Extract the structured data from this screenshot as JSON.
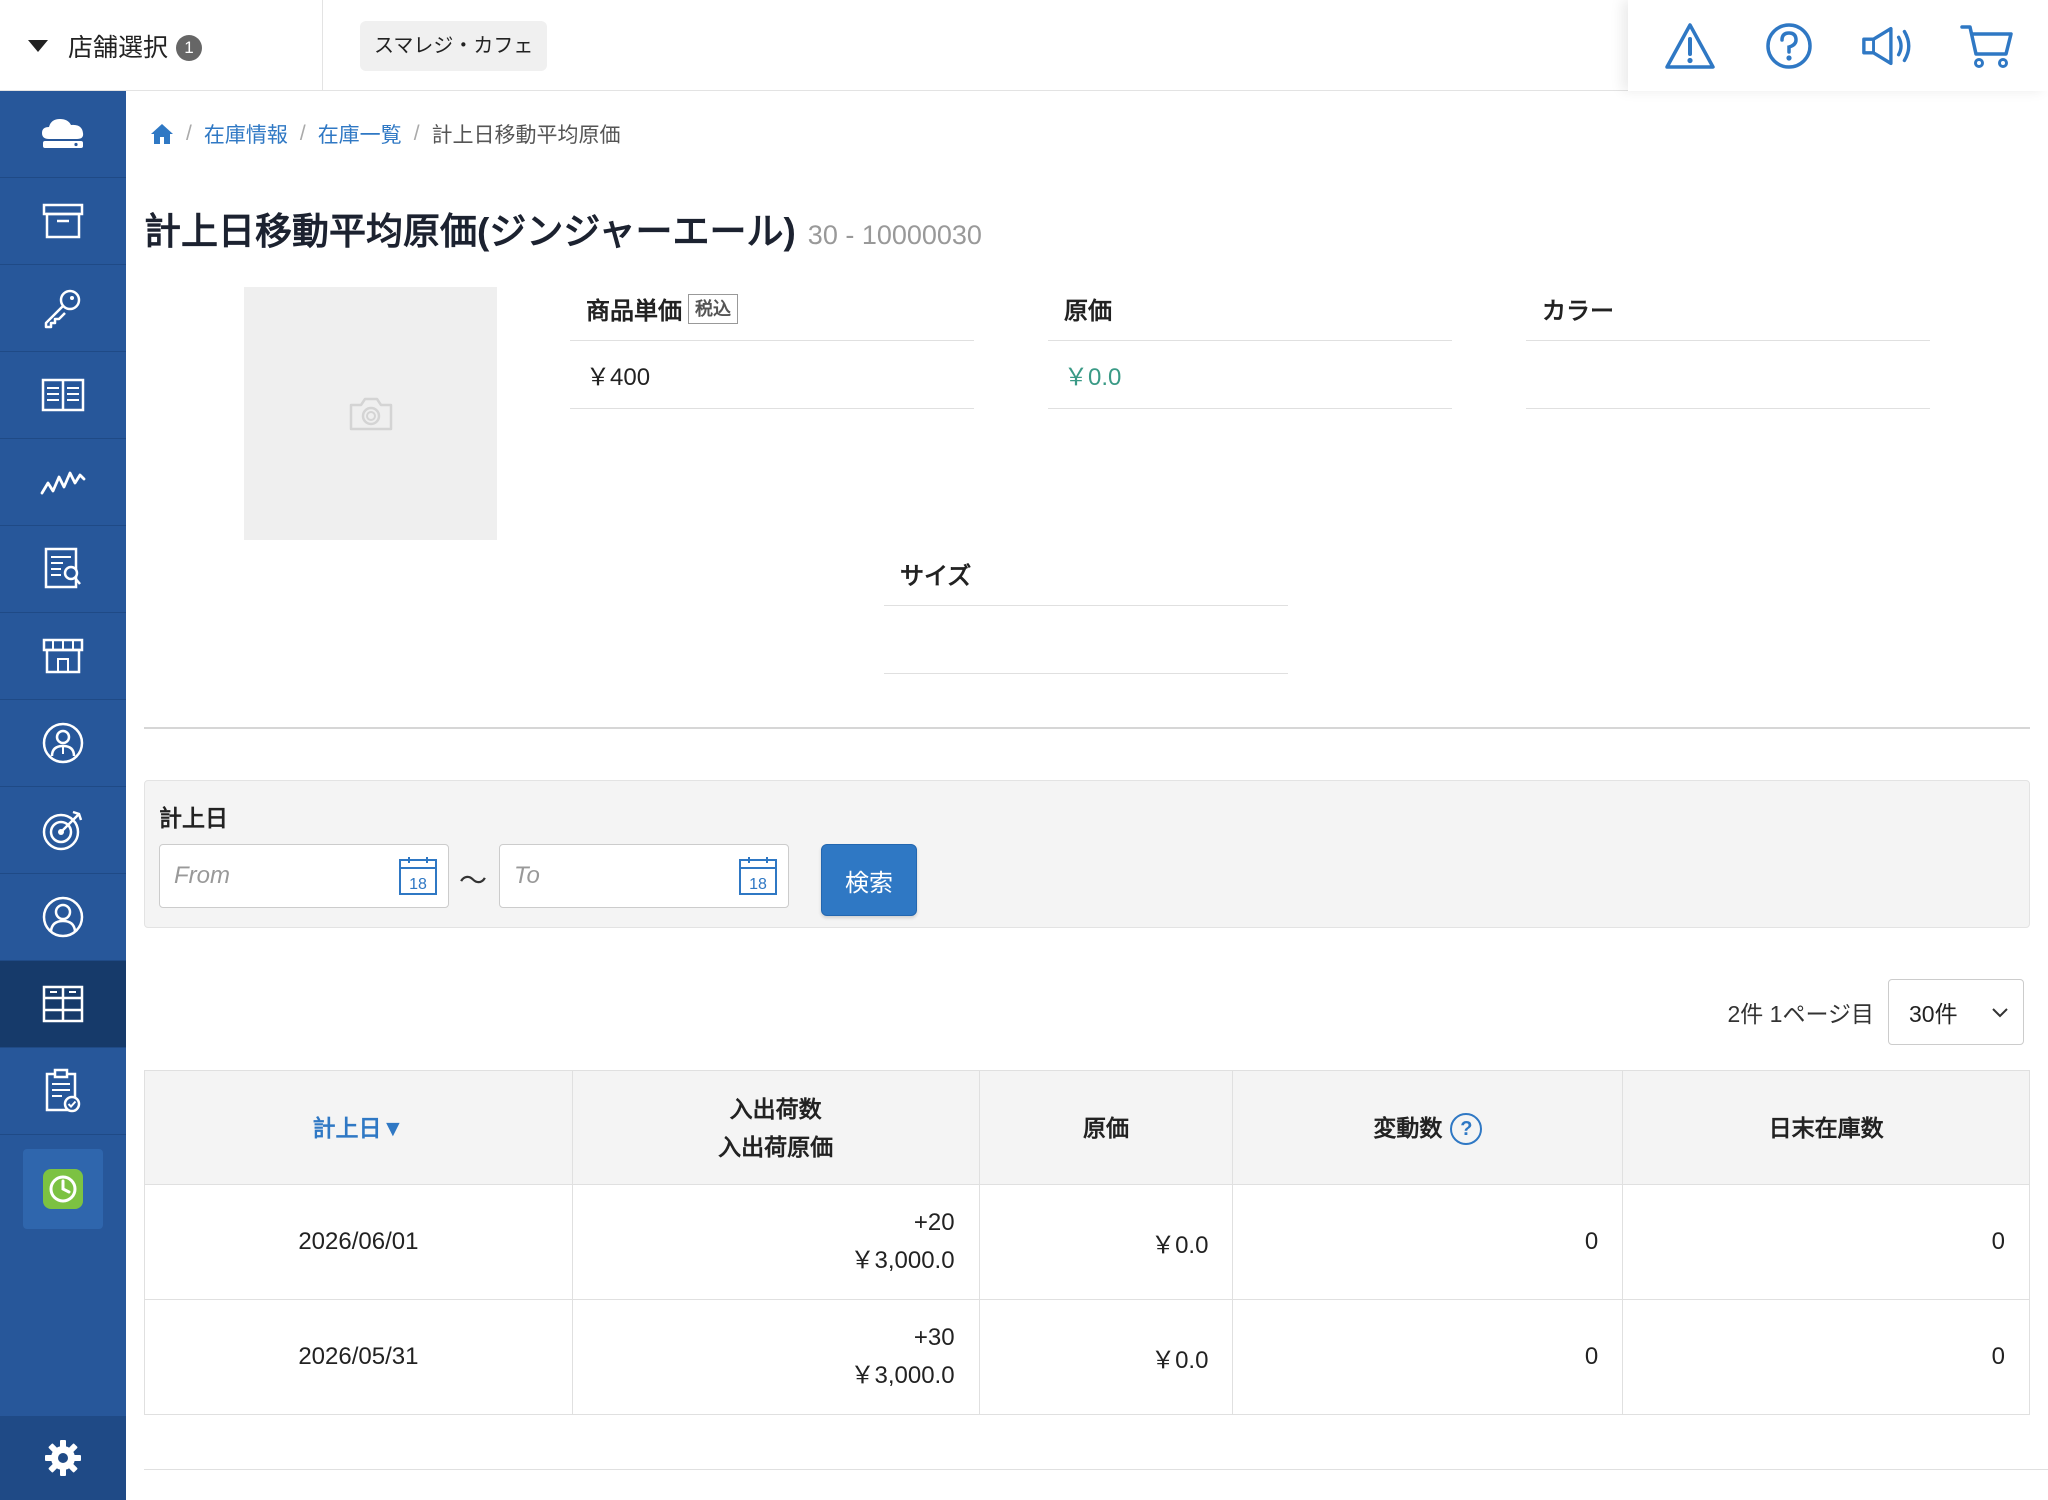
{
  "header": {
    "store_select_label": "店舗選択",
    "store_select_badge": "1",
    "current_store": "スマレジ・カフェ"
  },
  "icons": {
    "top": [
      "warning-icon",
      "help-icon",
      "announcement-icon",
      "cart-icon"
    ],
    "sidebar": [
      "cloud-icon",
      "archive-icon",
      "key-icon",
      "book-icon",
      "chart-icon",
      "report-icon",
      "store-icon",
      "staff-icon",
      "target-icon",
      "customer-icon",
      "inventory-icon",
      "clipboard-icon",
      "clock-icon",
      "gear-icon"
    ]
  },
  "breadcrumb": {
    "items": [
      "在庫情報",
      "在庫一覧"
    ],
    "current": "計上日移動平均原価"
  },
  "page": {
    "title": "計上日移動平均原価(ジンジャーエール)",
    "code": "30 - 10000030"
  },
  "attributes": {
    "price_label": "商品単価",
    "tax_badge": "税込",
    "price_value": "￥400",
    "cost_label": "原価",
    "cost_value": "￥0.0",
    "color_label": "カラー",
    "color_value": "",
    "size_label": "サイズ",
    "size_value": ""
  },
  "filter": {
    "label": "計上日",
    "from_placeholder": "From",
    "to_placeholder": "To",
    "calendar_day": "18",
    "range_separator": "～",
    "search_button": "検索"
  },
  "pager": {
    "summary": "2件 1ページ目",
    "per_page": "30件"
  },
  "table": {
    "headers": {
      "date": "計上日▼",
      "qty_line1": "入出荷数",
      "qty_line2": "入出荷原価",
      "cost": "原価",
      "change": "変動数",
      "help": "?",
      "end_stock": "日末在庫数"
    },
    "rows": [
      {
        "date": "2026/06/01",
        "qty": "+20",
        "qty_cost": "￥3,000.0",
        "cost": "￥0.0",
        "change": "0",
        "end_stock": "0"
      },
      {
        "date": "2026/05/31",
        "qty": "+30",
        "qty_cost": "￥3,000.0",
        "cost": "￥0.0",
        "change": "0",
        "end_stock": "0"
      }
    ]
  },
  "colors": {
    "sidebar": "#27579a",
    "sidebar_active": "#163a6a",
    "accent": "#2f78c4",
    "green": "#4caa56",
    "teal": "#3a9a86",
    "clock_green": "#7cc242"
  }
}
